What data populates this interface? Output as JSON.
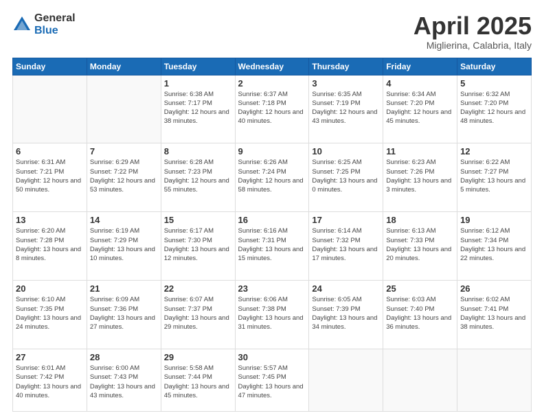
{
  "logo": {
    "general": "General",
    "blue": "Blue"
  },
  "header": {
    "month": "April 2025",
    "location": "Miglierina, Calabria, Italy"
  },
  "weekdays": [
    "Sunday",
    "Monday",
    "Tuesday",
    "Wednesday",
    "Thursday",
    "Friday",
    "Saturday"
  ],
  "days": [
    {
      "day": null,
      "info": null
    },
    {
      "day": null,
      "info": null
    },
    {
      "day": "1",
      "info": "Sunrise: 6:38 AM\nSunset: 7:17 PM\nDaylight: 12 hours\nand 38 minutes."
    },
    {
      "day": "2",
      "info": "Sunrise: 6:37 AM\nSunset: 7:18 PM\nDaylight: 12 hours\nand 40 minutes."
    },
    {
      "day": "3",
      "info": "Sunrise: 6:35 AM\nSunset: 7:19 PM\nDaylight: 12 hours\nand 43 minutes."
    },
    {
      "day": "4",
      "info": "Sunrise: 6:34 AM\nSunset: 7:20 PM\nDaylight: 12 hours\nand 45 minutes."
    },
    {
      "day": "5",
      "info": "Sunrise: 6:32 AM\nSunset: 7:20 PM\nDaylight: 12 hours\nand 48 minutes."
    },
    {
      "day": "6",
      "info": "Sunrise: 6:31 AM\nSunset: 7:21 PM\nDaylight: 12 hours\nand 50 minutes."
    },
    {
      "day": "7",
      "info": "Sunrise: 6:29 AM\nSunset: 7:22 PM\nDaylight: 12 hours\nand 53 minutes."
    },
    {
      "day": "8",
      "info": "Sunrise: 6:28 AM\nSunset: 7:23 PM\nDaylight: 12 hours\nand 55 minutes."
    },
    {
      "day": "9",
      "info": "Sunrise: 6:26 AM\nSunset: 7:24 PM\nDaylight: 12 hours\nand 58 minutes."
    },
    {
      "day": "10",
      "info": "Sunrise: 6:25 AM\nSunset: 7:25 PM\nDaylight: 13 hours\nand 0 minutes."
    },
    {
      "day": "11",
      "info": "Sunrise: 6:23 AM\nSunset: 7:26 PM\nDaylight: 13 hours\nand 3 minutes."
    },
    {
      "day": "12",
      "info": "Sunrise: 6:22 AM\nSunset: 7:27 PM\nDaylight: 13 hours\nand 5 minutes."
    },
    {
      "day": "13",
      "info": "Sunrise: 6:20 AM\nSunset: 7:28 PM\nDaylight: 13 hours\nand 8 minutes."
    },
    {
      "day": "14",
      "info": "Sunrise: 6:19 AM\nSunset: 7:29 PM\nDaylight: 13 hours\nand 10 minutes."
    },
    {
      "day": "15",
      "info": "Sunrise: 6:17 AM\nSunset: 7:30 PM\nDaylight: 13 hours\nand 12 minutes."
    },
    {
      "day": "16",
      "info": "Sunrise: 6:16 AM\nSunset: 7:31 PM\nDaylight: 13 hours\nand 15 minutes."
    },
    {
      "day": "17",
      "info": "Sunrise: 6:14 AM\nSunset: 7:32 PM\nDaylight: 13 hours\nand 17 minutes."
    },
    {
      "day": "18",
      "info": "Sunrise: 6:13 AM\nSunset: 7:33 PM\nDaylight: 13 hours\nand 20 minutes."
    },
    {
      "day": "19",
      "info": "Sunrise: 6:12 AM\nSunset: 7:34 PM\nDaylight: 13 hours\nand 22 minutes."
    },
    {
      "day": "20",
      "info": "Sunrise: 6:10 AM\nSunset: 7:35 PM\nDaylight: 13 hours\nand 24 minutes."
    },
    {
      "day": "21",
      "info": "Sunrise: 6:09 AM\nSunset: 7:36 PM\nDaylight: 13 hours\nand 27 minutes."
    },
    {
      "day": "22",
      "info": "Sunrise: 6:07 AM\nSunset: 7:37 PM\nDaylight: 13 hours\nand 29 minutes."
    },
    {
      "day": "23",
      "info": "Sunrise: 6:06 AM\nSunset: 7:38 PM\nDaylight: 13 hours\nand 31 minutes."
    },
    {
      "day": "24",
      "info": "Sunrise: 6:05 AM\nSunset: 7:39 PM\nDaylight: 13 hours\nand 34 minutes."
    },
    {
      "day": "25",
      "info": "Sunrise: 6:03 AM\nSunset: 7:40 PM\nDaylight: 13 hours\nand 36 minutes."
    },
    {
      "day": "26",
      "info": "Sunrise: 6:02 AM\nSunset: 7:41 PM\nDaylight: 13 hours\nand 38 minutes."
    },
    {
      "day": "27",
      "info": "Sunrise: 6:01 AM\nSunset: 7:42 PM\nDaylight: 13 hours\nand 40 minutes."
    },
    {
      "day": "28",
      "info": "Sunrise: 6:00 AM\nSunset: 7:43 PM\nDaylight: 13 hours\nand 43 minutes."
    },
    {
      "day": "29",
      "info": "Sunrise: 5:58 AM\nSunset: 7:44 PM\nDaylight: 13 hours\nand 45 minutes."
    },
    {
      "day": "30",
      "info": "Sunrise: 5:57 AM\nSunset: 7:45 PM\nDaylight: 13 hours\nand 47 minutes."
    },
    {
      "day": null,
      "info": null
    },
    {
      "day": null,
      "info": null
    },
    {
      "day": null,
      "info": null
    }
  ]
}
